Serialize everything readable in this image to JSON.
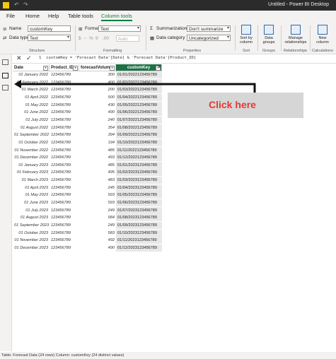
{
  "title_bar": {
    "title": "Untitled - Power BI Desktop",
    "undo_icon": "undo-icon",
    "redo_icon": "redo-icon"
  },
  "menu": {
    "tabs": [
      "File",
      "Home",
      "Help",
      "Table tools",
      "Column tools"
    ],
    "active_tab": "Column tools"
  },
  "ribbon": {
    "structure": {
      "name_label": "Name",
      "name_value": "customKey",
      "datatype_label": "Data type",
      "datatype_value": "Text",
      "group_label": "Structure"
    },
    "formatting": {
      "format_label": "Format",
      "format_value": "Text",
      "symbols": [
        "$",
        "~",
        "%",
        "9",
        ".00"
      ],
      "auto_label": "Auto",
      "group_label": "Formatting"
    },
    "properties": {
      "summarization_label": "Summarization",
      "summarization_value": "Don't summarize",
      "category_label": "Data category",
      "category_value": "Uncategorized",
      "group_label": "Properties"
    },
    "sort": {
      "button": "Sort by column",
      "group_label": "Sort"
    },
    "groups": {
      "button": "Data groups",
      "group_label": "Groups"
    },
    "relationships": {
      "button": "Manage relationships",
      "group_label": "Relationships"
    },
    "calculations": {
      "button": "New column",
      "group_label": "Calculations"
    }
  },
  "formula_bar": {
    "line_no": "1",
    "formula": "customKey = 'Forecast Data'[Date] & 'Forecast Data'[Product_ID]"
  },
  "table": {
    "columns": [
      "Date",
      "Product_ID",
      "forecastVolume",
      "customKey"
    ],
    "rows": [
      [
        "01 January 2022",
        "123456789",
        "300",
        "01/01/2022123456789"
      ],
      [
        "01 February 2022",
        "123456789",
        "400",
        "01/02/2022123456789"
      ],
      [
        "01 March 2022",
        "123456789",
        "200",
        "01/03/2022123456789"
      ],
      [
        "01 April 2022",
        "123456789",
        "500",
        "01/04/2022123456789"
      ],
      [
        "01 May 2022",
        "123456789",
        "430",
        "01/05/2022123456789"
      ],
      [
        "01 June 2022",
        "123456789",
        "490",
        "01/06/2022123456789"
      ],
      [
        "01 July 2022",
        "123456789",
        "240",
        "01/07/2022123456789"
      ],
      [
        "01 August 2022",
        "123456789",
        "354",
        "01/08/2022123456789"
      ],
      [
        "01 September 2022",
        "123456789",
        "394",
        "01/09/2022123456789"
      ],
      [
        "01 October 2022",
        "123456789",
        "194",
        "01/10/2022123456789"
      ],
      [
        "01 November 2022",
        "123456789",
        "485",
        "01/11/2022123456789"
      ],
      [
        "01 December 2022",
        "123456789",
        "493",
        "01/12/2022123456789"
      ],
      [
        "01 January 2023",
        "123456789",
        "485",
        "01/01/2023123456789"
      ],
      [
        "01 February 2023",
        "123456789",
        "495",
        "01/02/2023123456789"
      ],
      [
        "01 March 2023",
        "123456789",
        "483",
        "01/03/2023123456789"
      ],
      [
        "01 April 2023",
        "123456789",
        "245",
        "01/04/2023123456789"
      ],
      [
        "01 May 2023",
        "123456789",
        "593",
        "01/05/2023123456789"
      ],
      [
        "01 June 2023",
        "123456789",
        "593",
        "01/06/2023123456789"
      ],
      [
        "01 July 2023",
        "123456789",
        "249",
        "01/07/2023123456789"
      ],
      [
        "01 August 2023",
        "123456789",
        "584",
        "01/08/2023123456789"
      ],
      [
        "01 September 2023",
        "123456789",
        "249",
        "01/09/2023123456789"
      ],
      [
        "01 October 2023",
        "123456789",
        "583",
        "01/10/2023123456789"
      ],
      [
        "01 November 2023",
        "123456789",
        "492",
        "01/11/2023123456789"
      ],
      [
        "01 December 2023",
        "123456789",
        "490",
        "01/12/2023123456789"
      ]
    ]
  },
  "annotation": {
    "callout_text": "Click here",
    "arrow_color": "#111111",
    "callout_text_color": "#e53935"
  },
  "status_bar": {
    "text": "Table: Forecast Data (24 rows) Column: customKey (24 distinct values)"
  },
  "colors": {
    "accent": "#107c41",
    "selected_header": "#1e7145",
    "titlebar": "#2b2b2b"
  }
}
